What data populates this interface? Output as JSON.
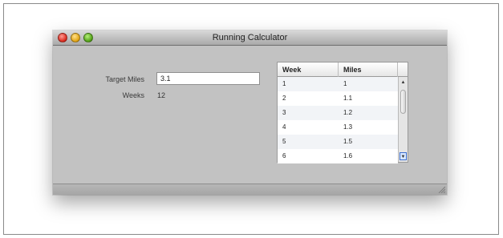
{
  "window": {
    "title": "Running Calculator"
  },
  "form": {
    "target_label": "Target Miles",
    "target_value": "3.1",
    "weeks_label": "Weeks",
    "weeks_value": "12"
  },
  "table": {
    "headers": {
      "week": "Week",
      "miles": "Miles"
    },
    "rows": [
      {
        "week": "1",
        "miles": "1"
      },
      {
        "week": "2",
        "miles": "1.1"
      },
      {
        "week": "3",
        "miles": "1.2"
      },
      {
        "week": "4",
        "miles": "1.3"
      },
      {
        "week": "5",
        "miles": "1.5"
      },
      {
        "week": "6",
        "miles": "1.6"
      }
    ],
    "scroll": {
      "up_icon": "▲",
      "down_icon": "▼",
      "fraction": 0.1
    }
  }
}
